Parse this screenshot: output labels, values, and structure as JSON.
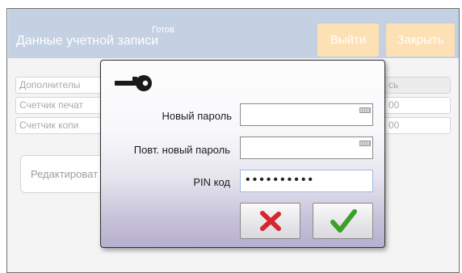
{
  "header": {
    "status": "Готов",
    "title": "Данные учетной записи",
    "logout_label": "Выйти",
    "close_label": "Закрыть"
  },
  "background": {
    "rows": [
      {
        "label": "Дополнителы",
        "value": "сь"
      },
      {
        "label": "Счетчик печат",
        "value": "00"
      },
      {
        "label": "Счетчик копи",
        "value": "00"
      }
    ],
    "edit_label": "Редактироват"
  },
  "dialog": {
    "icon": "key-icon",
    "new_password_label": "Новый пароль",
    "new_password_value": "",
    "repeat_password_label": "Повт. новый пароль",
    "repeat_password_value": "",
    "pin_label": "PIN код",
    "pin_value": "••••••••••",
    "cancel_icon": "x-icon",
    "confirm_icon": "checkmark-icon"
  },
  "colors": {
    "header_bg": "#c4d1e2",
    "header_button_bg": "#fde0b4",
    "cancel_red": "#d8262e",
    "confirm_green": "#3ca028"
  }
}
